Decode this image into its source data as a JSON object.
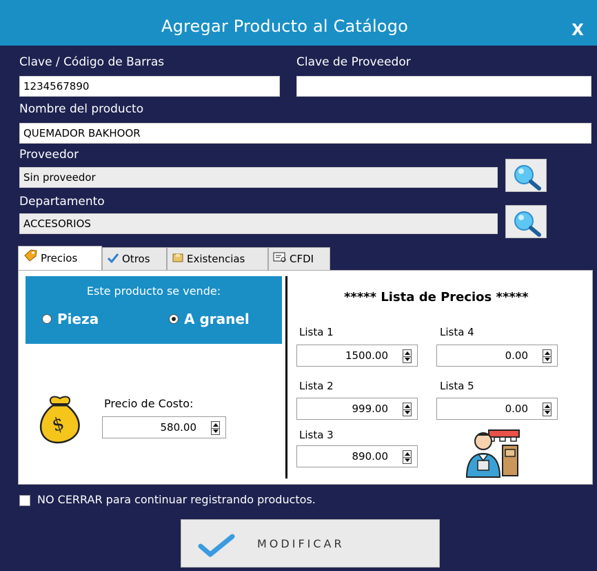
{
  "window": {
    "title": "Agregar Producto al Catálogo",
    "close_label": "X"
  },
  "fields": {
    "clave_label": "Clave / Código de Barras",
    "clave_value": "1234567890",
    "clave_prov_label": "Clave de Proveedor",
    "clave_prov_value": "",
    "nombre_label": "Nombre del producto",
    "nombre_value": "QUEMADOR BAKHOOR",
    "proveedor_label": "Proveedor",
    "proveedor_value": "Sin proveedor",
    "departamento_label": "Departamento",
    "departamento_value": "ACCESORIOS"
  },
  "tabs": [
    {
      "label": "Precios",
      "icon": "price-tag-icon",
      "active": true
    },
    {
      "label": "Otros",
      "icon": "checkmark-icon"
    },
    {
      "label": "Existencias",
      "icon": "box-icon"
    },
    {
      "label": "CFDI",
      "icon": "invoice-icon"
    }
  ],
  "precios": {
    "sells_label": "Este producto se vende:",
    "radio_pieza": "Pieza",
    "radio_granel": "A granel",
    "selected": "A granel",
    "costo_label": "Precio de Costo:",
    "costo_value": "580.00",
    "lista_header": "***** Lista de Precios *****",
    "listas": [
      {
        "label": "Lista 1",
        "value": "1500.00"
      },
      {
        "label": "Lista 2",
        "value": "999.00"
      },
      {
        "label": "Lista 3",
        "value": "890.00"
      },
      {
        "label": "Lista 4",
        "value": "0.00"
      },
      {
        "label": "Lista 5",
        "value": "0.00"
      }
    ]
  },
  "no_cerrar_label": "NO CERRAR para continuar registrando productos.",
  "modificar_label": "MODIFICAR",
  "colors": {
    "titlebar": "#1a8fc6",
    "background": "#1d2250",
    "accent_blue": "#1a8fc6"
  }
}
